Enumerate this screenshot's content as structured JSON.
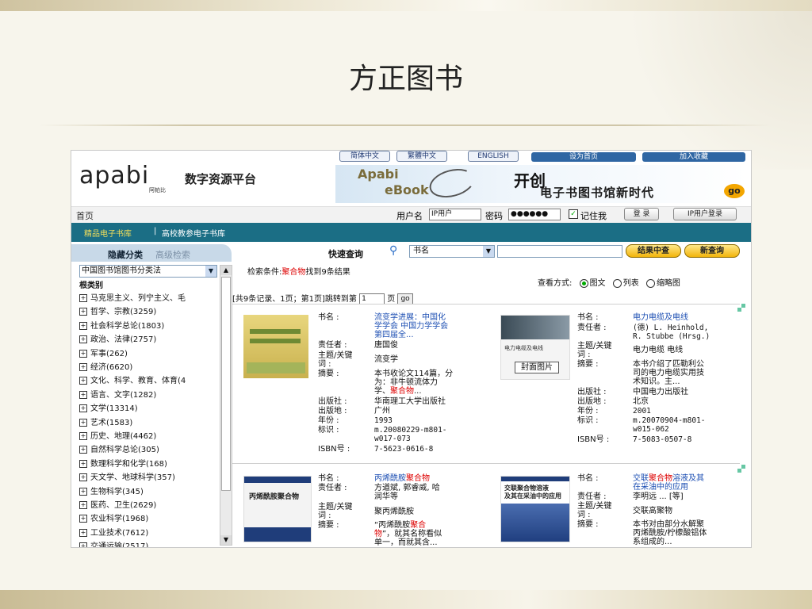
{
  "slide": {
    "title": "方正图书"
  },
  "header": {
    "logo": "apabi",
    "logo_sub": "阿帕比",
    "brand": "数字资源平台",
    "links": [
      "简体中文",
      "繁體中文",
      "ENGLISH"
    ],
    "set_home": "设为首页",
    "add_fav": "加入收藏",
    "banner": {
      "apabi": "Apabi",
      "ebook": "eBook",
      "kai": "开创",
      "slogan": "电子书图书馆新时代",
      "go": "go"
    }
  },
  "login": {
    "home": "首页",
    "username_label": "用户名",
    "username_value": "IP用户",
    "password_label": "密码",
    "password_value": "●●●●●●",
    "remember_label": "记住我",
    "login_button": "登 录",
    "ip_login_button": "IP用户登录"
  },
  "nav": {
    "items": [
      "精品电子书库",
      "|",
      "高校教参电子书库"
    ]
  },
  "left_panel": {
    "hide": "隐藏分类",
    "advanced": "高级检索",
    "classification": "中国图书馆图书分类法",
    "root": "根类别",
    "categories": [
      "马克思主义、列宁主义、毛",
      "哲学、宗教(3259)",
      "社会科学总论(1803)",
      "政治、法律(2757)",
      "军事(262)",
      "经济(6620)",
      "文化、科学、教育、体育(4",
      "语言、文字(1282)",
      "文学(13314)",
      "艺术(1583)",
      "历史、地理(4462)",
      "自然科学总论(305)",
      "数理科学和化学(168)",
      "天文学、地球科学(357)",
      "生物科学(345)",
      "医药、卫生(2629)",
      "农业科学(1968)",
      "工业技术(7612)",
      "交通运输(2517)"
    ]
  },
  "search": {
    "label": "快速查询",
    "field": "书名",
    "within": "结果中查",
    "new": "新查询",
    "condition_prefix": "检索条件:",
    "condition_term": "聚合物",
    "condition_suffix": "找到9条结果",
    "view_label": "查看方式:",
    "view_options": [
      "图文",
      "列表",
      "缩略图"
    ],
    "pager_prefix": "[共9条记录、1页；第1页]跳转到第",
    "pager_value": "1",
    "pager_unit": "页",
    "pager_go": "go"
  },
  "labels": {
    "title": "书名 :",
    "author": "责任者 :",
    "subject1": "主题/关键",
    "subject2": "词 :",
    "abstract": "摘要 :",
    "publisher": "出版社 :",
    "place": "出版地 :",
    "year": "年份 :",
    "id": "标识 :",
    "isbn": "ISBN号 :",
    "cover_image": "封面图片"
  },
  "books": [
    {
      "title_lines": [
        "流变学进展：中国化",
        "学学会 中国力学学会",
        "第四届全..."
      ],
      "author": "唐国俊",
      "subject": "流变学",
      "abstract_lines": [
        "本书收论文114篇，分",
        "为：非牛顿流体力"
      ],
      "abstract_tail_pre": "学、",
      "abstract_tail_hl": "聚合物",
      "abstract_tail_post": "...",
      "publisher": "华南理工大学出版社",
      "place": "广州",
      "year": "1993",
      "id_lines": [
        "m.20080229-m801-",
        "w017-073"
      ],
      "isbn": "7-5623-0616-8"
    },
    {
      "title_lines": [
        "电力电缆及电线"
      ],
      "author_lines": [
        "(德) L. Heinhold,",
        "R. Stubbe (Hrsg.)"
      ],
      "subject": "电力电缆 电线",
      "abstract_lines": [
        "本书介绍了匹勒利公",
        "司的电力电缆实用技",
        "术知识。主..."
      ],
      "publisher": "中国电力出版社",
      "place": "北京",
      "year": "2001",
      "id_lines": [
        "m.20070904-m801-",
        "w015-062"
      ],
      "isbn": "7-5083-0507-8",
      "cover_text": "电力电缆及电线"
    },
    {
      "title_pre": "丙烯酰胺",
      "title_hl": "聚合物",
      "author_lines": [
        "方道斌, 郭睿威, 哈",
        "润华等"
      ],
      "subject": "聚丙烯酰胺",
      "abstract_l1_pre": "“丙烯酰胺",
      "abstract_l1_hl": "聚合",
      "abstract_l2_hl": "物",
      "abstract_l2_post": "”，就其名称看似",
      "abstract_l3": "单一，而就其含...",
      "cover_text": "丙烯酰胺聚合物"
    },
    {
      "title_l1_pre": "交联",
      "title_l1_hl": "聚合物",
      "title_l1_post": "溶液及其",
      "title_l2": "在采油中的应用",
      "author": "李明远 ... [等]",
      "subject": "交联高聚物",
      "abstract_lines": [
        "本书对由部分水解聚",
        "丙烯酰胺/柠檬酸铝体",
        "系组成的..."
      ],
      "cover_text_lines": [
        "交联聚合物溶液",
        "及其在采油中的应用"
      ]
    }
  ],
  "colors": {
    "nav": "#1b6e85",
    "highlight": "#dd0000",
    "link": "#1d4fb3",
    "accent": "#f2b40b"
  }
}
